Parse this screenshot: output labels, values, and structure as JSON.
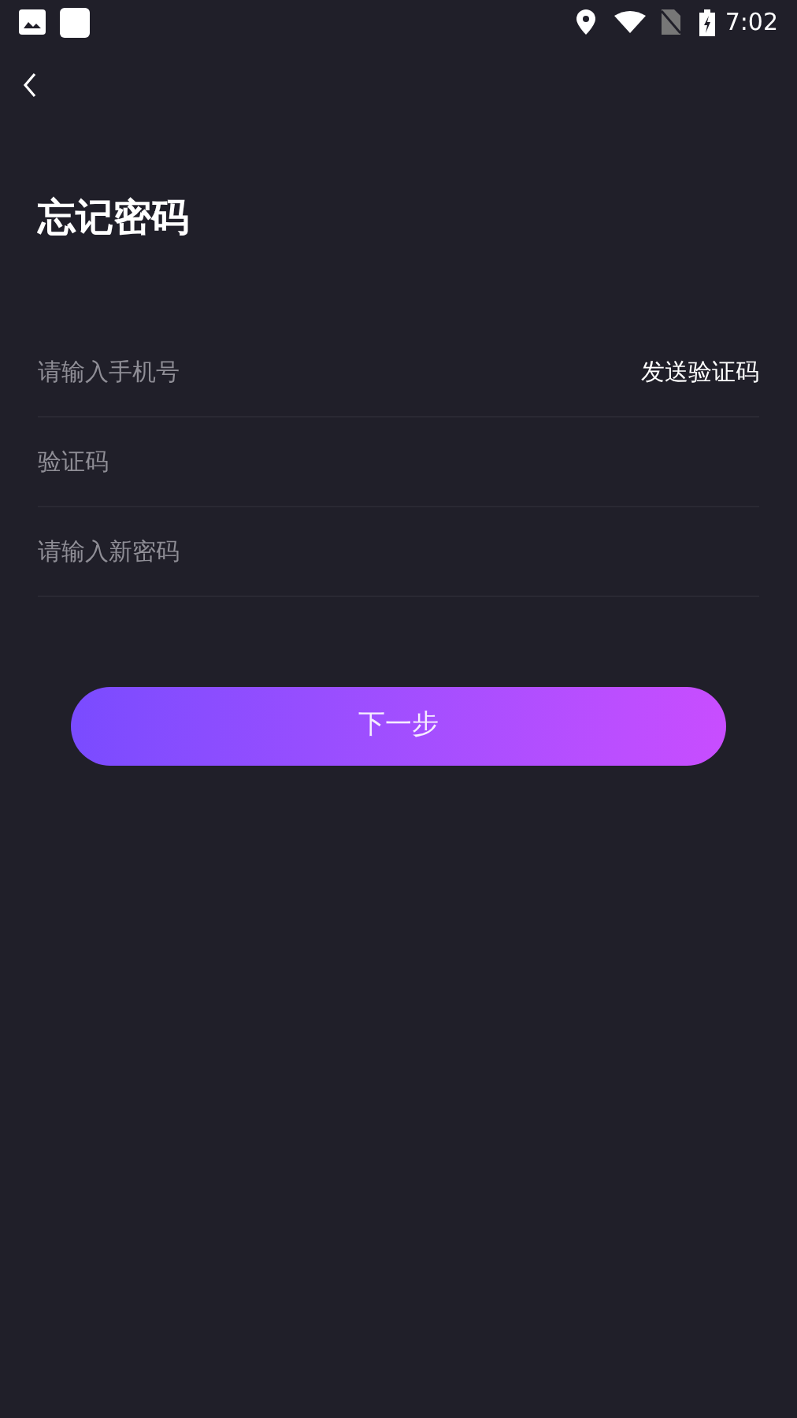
{
  "status_bar": {
    "time": "7:02"
  },
  "title": "忘记密码",
  "fields": [
    {
      "placeholder": "请输入手机号",
      "action": "发送验证码"
    },
    {
      "placeholder": "验证码"
    },
    {
      "placeholder": "请输入新密码"
    }
  ],
  "primary_button": "下一步"
}
